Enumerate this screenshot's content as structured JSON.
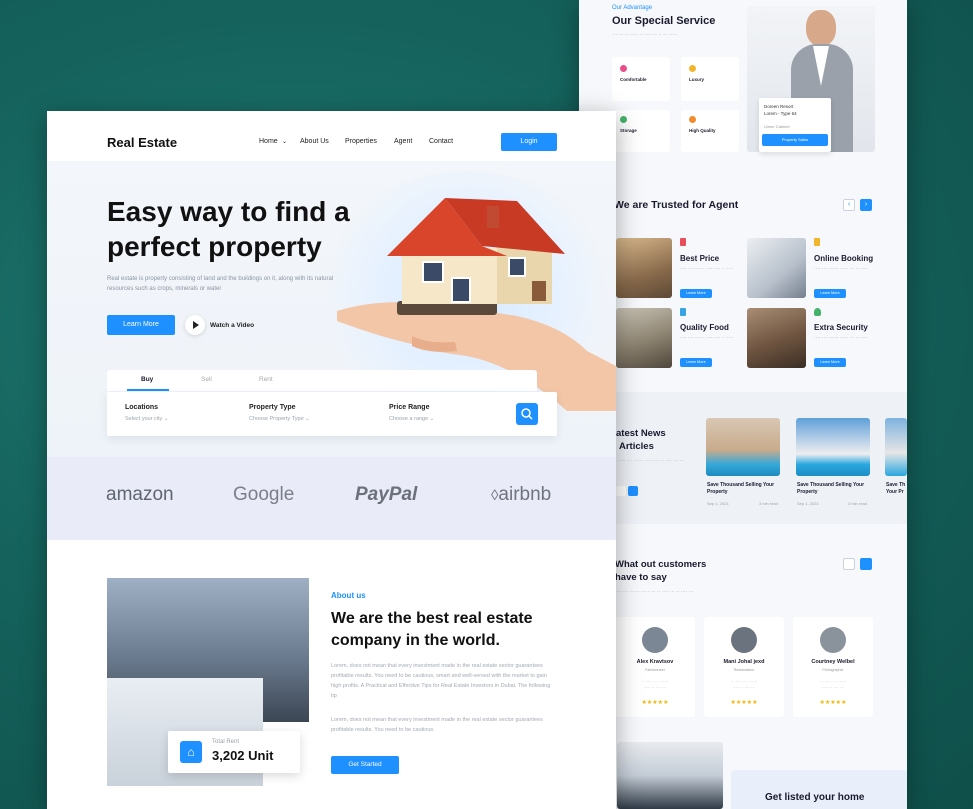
{
  "back": {
    "special": {
      "tag": "Our Advantage",
      "title": "Our Special Service",
      "items": [
        "Comfortable",
        "Luxury",
        "Storage",
        "High Quality"
      ],
      "agent_card": {
        "name": "Doreen Resort",
        "line": "Lorem - Type 64",
        "left": "Ulmer Cabinet",
        "button": "Property Sales"
      }
    },
    "trusted": {
      "title": "We are Trusted for Agent",
      "items": [
        "Best Price",
        "Online Booking",
        "Quality Food",
        "Extra Security"
      ],
      "button": "Learn More"
    },
    "news": {
      "title_1": "atest News",
      "title_2": "Articles",
      "cards": [
        {
          "title": "Save Thousand Selling Your Property",
          "date": "Sep 1, 2024",
          "read": "3 min read"
        },
        {
          "title": "Save Thousand Selling Your Property",
          "date": "Sep 1, 2024",
          "read": "3 min read"
        },
        {
          "title": "Save Th Your Pr"
        }
      ]
    },
    "customers": {
      "title_1": "What out customers",
      "title_2": "have to say",
      "people": [
        {
          "name": "Alex Kravtsov",
          "role": "Fashionrarer",
          "stars": "★★★★★"
        },
        {
          "name": "Mani Johal jexd",
          "role": "Restaurateur",
          "stars": "★★★★★"
        },
        {
          "name": "Courtney Welbel",
          "role": "Photographer",
          "stars": "★★★★★"
        }
      ]
    },
    "cta": "Get listed your home"
  },
  "nav": {
    "logo": "Real Estate",
    "items": [
      "Home",
      "About Us",
      "Properties",
      "Agent",
      "Contact"
    ],
    "login": "Login"
  },
  "hero": {
    "title_1": "Easy way to find a",
    "title_2": "perfect property",
    "desc": "Real estate is property consisting of land and the buildings on it, along with its natural resources such as crops, minerals or water",
    "learn_more": "Learn More",
    "watch": "Watch a Video"
  },
  "search": {
    "tabs": [
      "Buy",
      "Sell",
      "Rent"
    ],
    "fields": [
      {
        "label": "Locations",
        "value": "Select your city"
      },
      {
        "label": "Property Type",
        "value": "Choose Property Type"
      },
      {
        "label": "Price Range",
        "value": "Choose a range"
      }
    ]
  },
  "partners": [
    "amazon",
    "Google",
    "PayPal",
    "airbnb"
  ],
  "about": {
    "tag": "About us",
    "title": "We are the best real estate company in the world.",
    "p1": "Lorem, does not mean that every investment made in the real estate sector guarantees profitable results. You need to be cautious, smart and well-versed with the market to gain high profits. A Practical and Effective Tips for Real Estate Investors in Dubai. The following tip",
    "p2": "Lorem, does not mean that every investment made in the real estate sector guarantees profitable results. You need to be cautious.",
    "stat_label": "Total Rent",
    "stat_value": "3,202 Unit",
    "button": "Get Started"
  },
  "colors": {
    "accent": "#1e90ff",
    "roof": "#d9452b",
    "backdrop": "#15625c"
  }
}
